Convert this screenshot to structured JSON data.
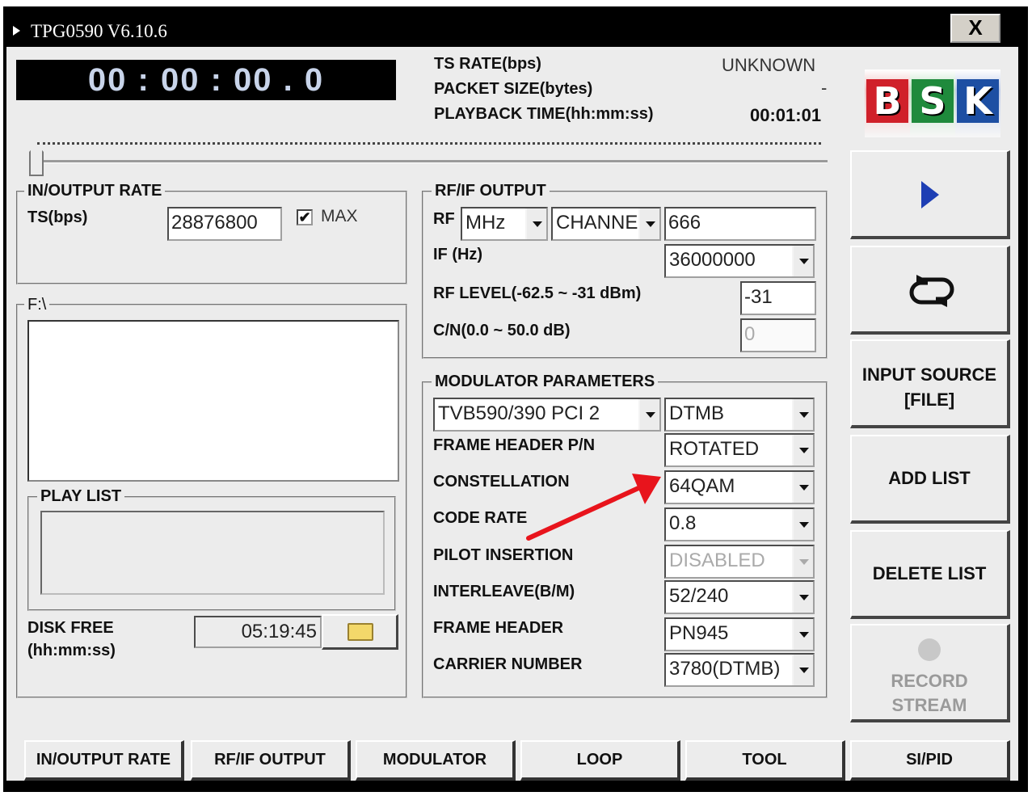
{
  "window": {
    "title": "TPG0590 V6.10.6",
    "close_label": "X"
  },
  "timer": "00 : 00 : 00 . 0",
  "stream_info": {
    "ts_rate_label": "TS RATE(bps)",
    "ts_rate_value": "UNKNOWN",
    "packet_size_label": "PACKET SIZE(bytes)",
    "packet_size_value": "-",
    "playback_time_label": "PLAYBACK TIME(hh:mm:ss)",
    "playback_time_value": "00:01:01"
  },
  "logo": {
    "letters": [
      "B",
      "S",
      "K"
    ],
    "colors": [
      "#d0202a",
      "#1f8a3c",
      "#1d4fa3"
    ]
  },
  "io_rate": {
    "title": "IN/OUTPUT RATE",
    "ts_label": "TS(bps)",
    "ts_value": "28876800",
    "max_label": "MAX",
    "max_checked": "✔"
  },
  "file_group": {
    "title": "F:\\"
  },
  "playlist": {
    "title": "PLAY LIST"
  },
  "disk_free": {
    "label_line1": "DISK FREE",
    "label_line2": "(hh:mm:ss)",
    "value": "05:19:45"
  },
  "rf_output": {
    "title": "RF/IF OUTPUT",
    "rf_label": "RF",
    "rf_unit": "MHz",
    "rf_mode": "CHANNE",
    "rf_value": "666",
    "if_label": "IF (Hz)",
    "if_value": "36000000",
    "rf_level_label": "RF LEVEL(-62.5 ~ -31 dBm)",
    "rf_level_value": "-31",
    "cn_label": "C/N(0.0 ~ 50.0 dB)",
    "cn_value": "0"
  },
  "modulator": {
    "title": "MODULATOR PARAMETERS",
    "device": "TVB590/390 PCI 2",
    "standard": "DTMB",
    "rows": [
      {
        "label": "FRAME HEADER P/N",
        "value": "ROTATED"
      },
      {
        "label": "CONSTELLATION",
        "value": "64QAM"
      },
      {
        "label": "CODE RATE",
        "value": "0.8"
      },
      {
        "label": "PILOT INSERTION",
        "value": "DISABLED"
      },
      {
        "label": "INTERLEAVE(B/M)",
        "value": "52/240"
      },
      {
        "label": "FRAME HEADER",
        "value": "PN945"
      },
      {
        "label": "CARRIER NUMBER",
        "value": "3780(DTMB)"
      }
    ]
  },
  "side_buttons": {
    "input_source_line1": "INPUT SOURCE",
    "input_source_line2": "[FILE]",
    "add_list": "ADD LIST",
    "delete_list": "DELETE LIST",
    "record_line1": "RECORD",
    "record_line2": "STREAM"
  },
  "tabs": [
    "IN/OUTPUT RATE",
    "RF/IF OUTPUT",
    "MODULATOR",
    "LOOP",
    "TOOL",
    "SI/PID"
  ],
  "colors": {
    "annotation_arrow": "#e8141c",
    "play_icon": "#1e3fb4"
  }
}
